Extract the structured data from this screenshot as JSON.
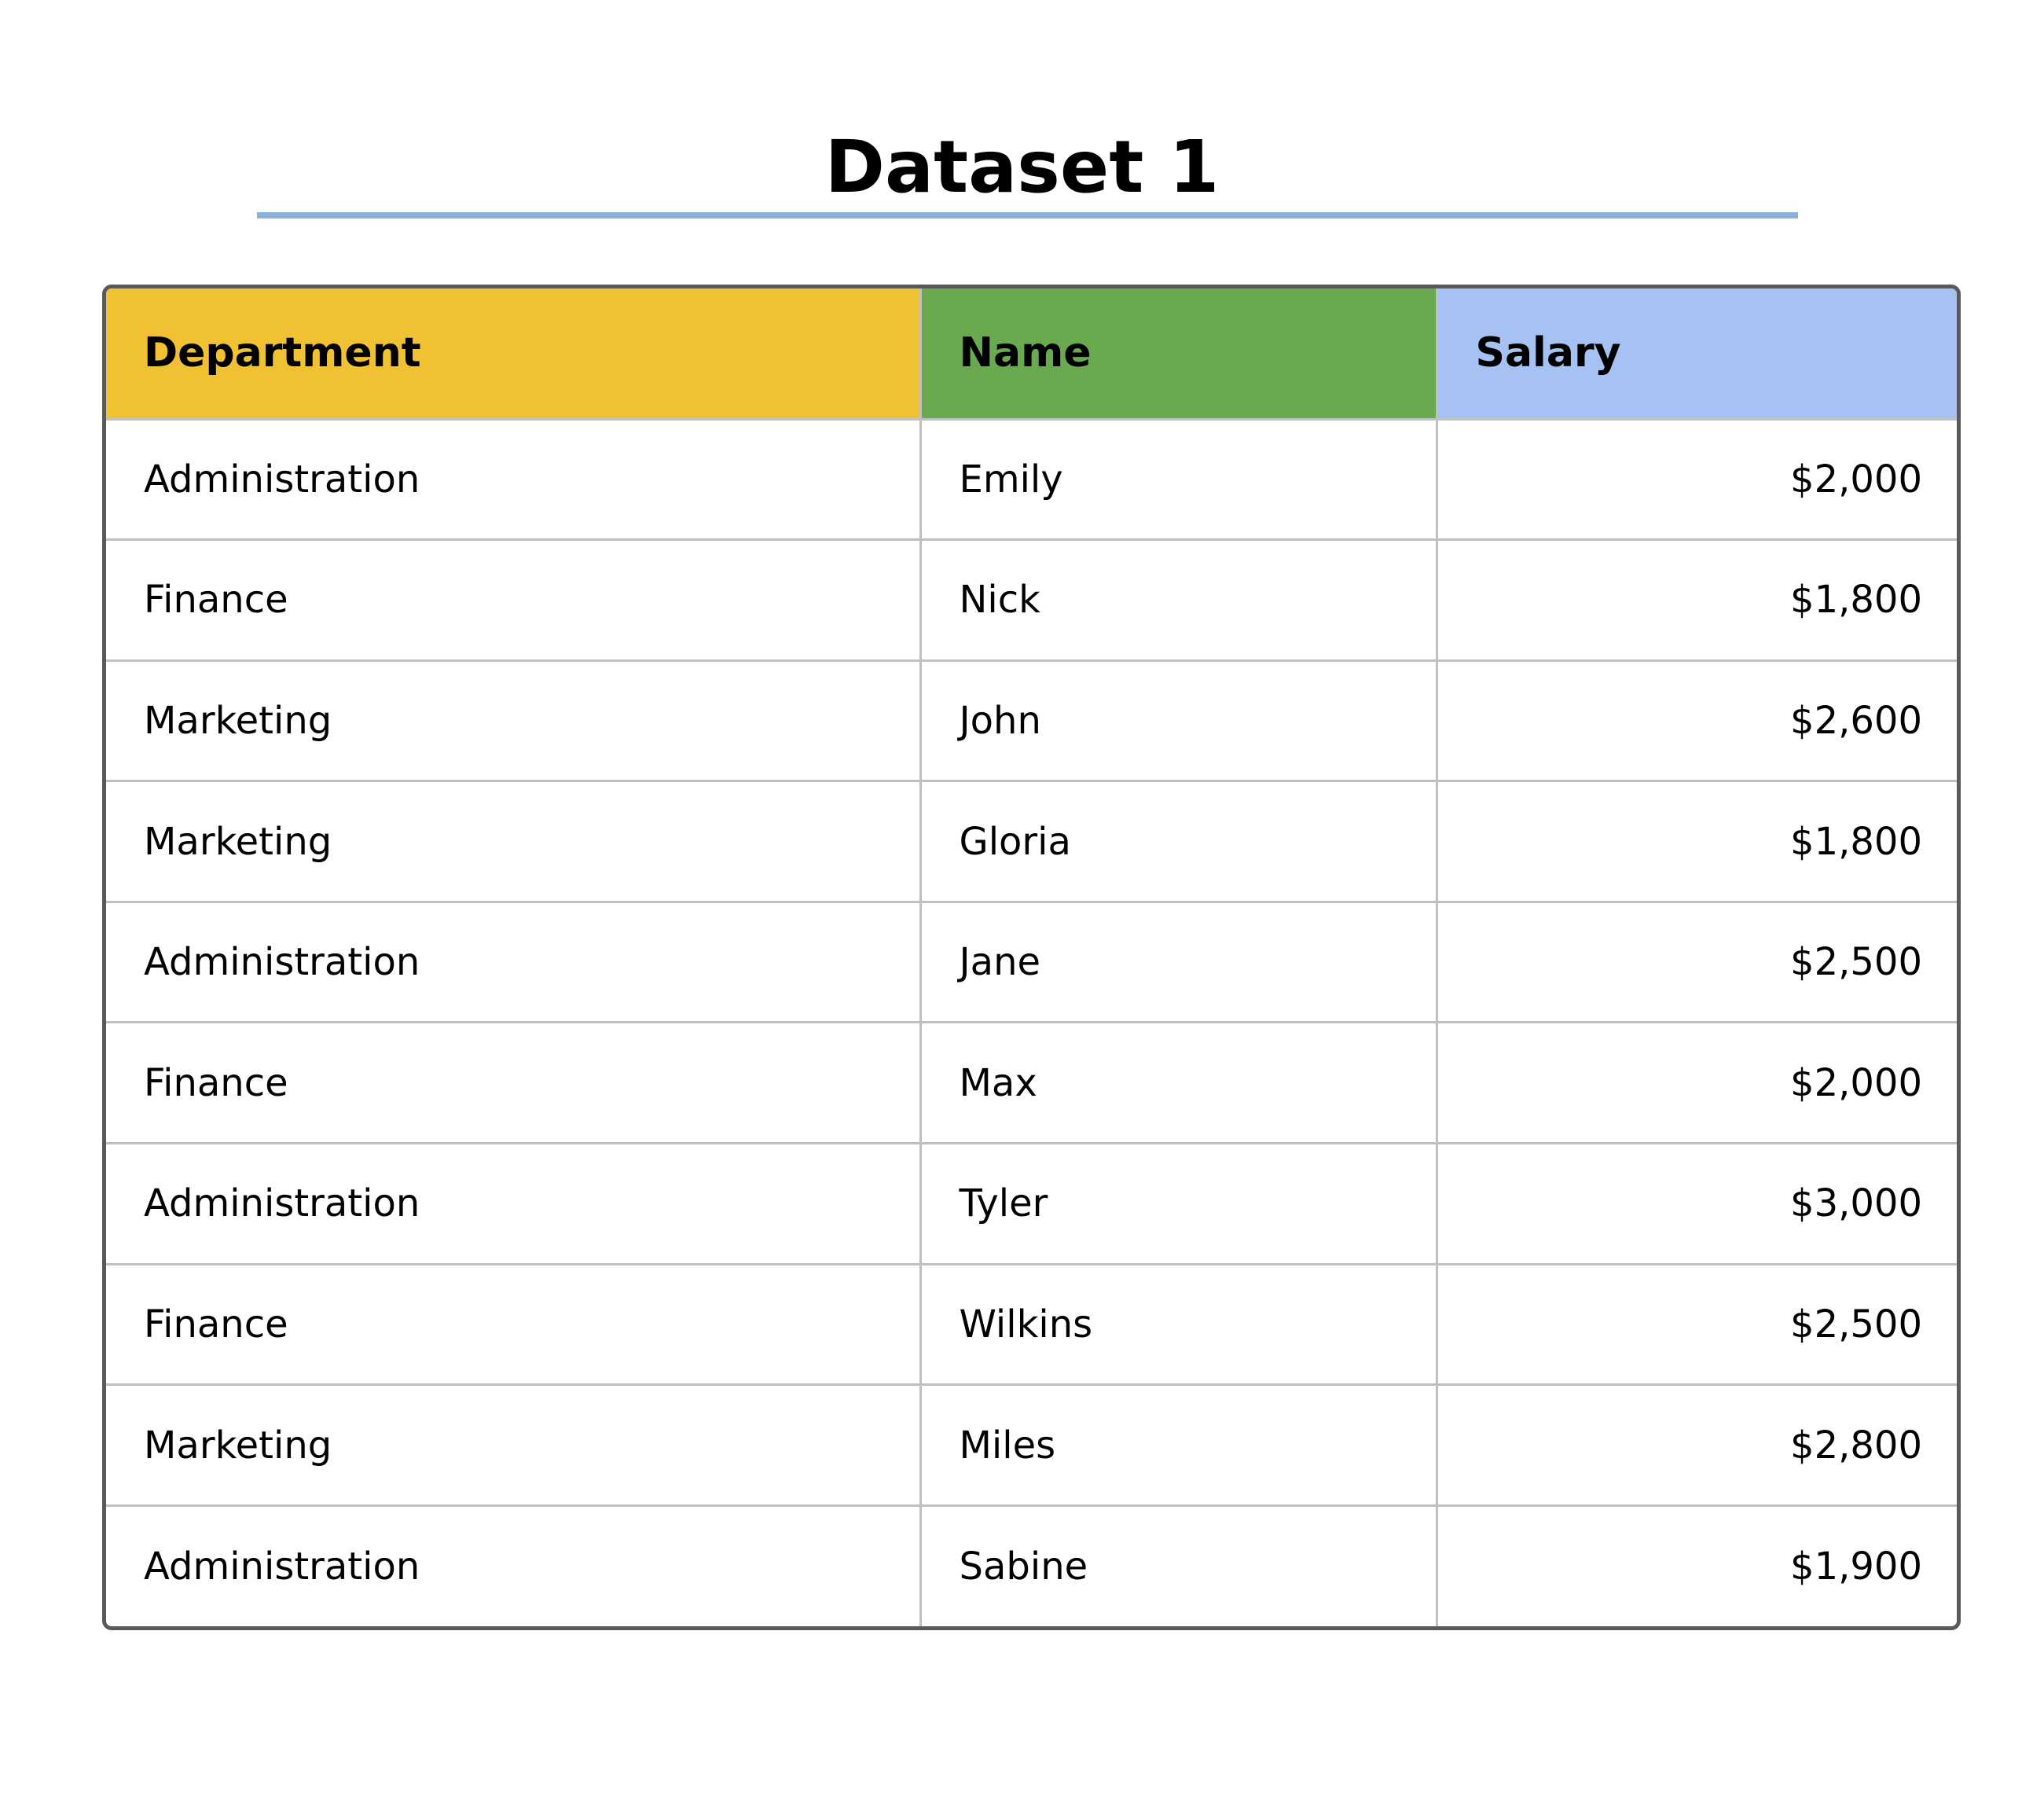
{
  "colors": {
    "header_department": "#f0c233",
    "header_name": "#69aa50",
    "header_salary": "#a5c2f2",
    "title_rule": "#8cb2de"
  },
  "chart_data": {
    "type": "table",
    "title": "Dataset 1",
    "columns": [
      "Department",
      "Name",
      "Salary"
    ],
    "rows": [
      [
        "Administration",
        "Emily",
        "$2,000"
      ],
      [
        "Finance",
        "Nick",
        "$1,800"
      ],
      [
        "Marketing",
        "John",
        "$2,600"
      ],
      [
        "Marketing",
        "Gloria",
        "$1,800"
      ],
      [
        "Administration",
        "Jane",
        "$2,500"
      ],
      [
        "Finance",
        "Max",
        "$2,000"
      ],
      [
        "Administration",
        "Tyler",
        "$3,000"
      ],
      [
        "Finance",
        "Wilkins",
        "$2,500"
      ],
      [
        "Marketing",
        "Miles",
        "$2,800"
      ],
      [
        "Administration",
        "Sabine",
        "$1,900"
      ]
    ]
  }
}
